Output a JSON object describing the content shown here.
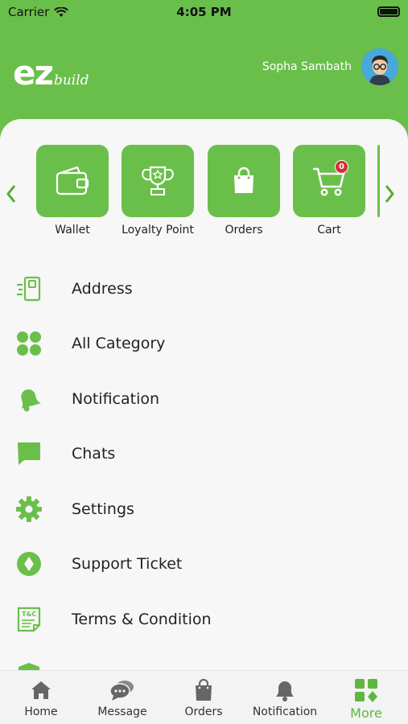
{
  "status_bar": {
    "carrier": "Carrier",
    "time": "4:05 PM"
  },
  "header": {
    "logo_main": "ez",
    "logo_sub": "build",
    "user_name": "Sopha Sambath"
  },
  "quick_actions": [
    {
      "label": "Wallet",
      "icon": "wallet-icon"
    },
    {
      "label": "Loyalty Point",
      "icon": "trophy-icon"
    },
    {
      "label": "Orders",
      "icon": "shopping-bag-icon"
    },
    {
      "label": "Cart",
      "icon": "cart-icon",
      "badge": "0"
    }
  ],
  "menu": [
    {
      "label": "Address",
      "icon": "address-icon"
    },
    {
      "label": "All Category",
      "icon": "category-icon"
    },
    {
      "label": "Notification",
      "icon": "bell-icon"
    },
    {
      "label": "Chats",
      "icon": "chat-icon"
    },
    {
      "label": "Settings",
      "icon": "gear-icon"
    },
    {
      "label": "Support Ticket",
      "icon": "ticket-icon"
    },
    {
      "label": "Terms & Condition",
      "icon": "terms-icon"
    }
  ],
  "tabs": [
    {
      "label": "Home",
      "icon": "home-icon",
      "active": false
    },
    {
      "label": "Message",
      "icon": "message-icon",
      "active": false
    },
    {
      "label": "Orders",
      "icon": "orders-bag-icon",
      "active": false
    },
    {
      "label": "Notification",
      "icon": "notification-bell-icon",
      "active": false
    },
    {
      "label": "More",
      "icon": "more-grid-icon",
      "active": true
    }
  ],
  "colors": {
    "brand_green": "#6abf4b",
    "badge_red": "#d32f2f",
    "active_tab": "#5fb640"
  }
}
